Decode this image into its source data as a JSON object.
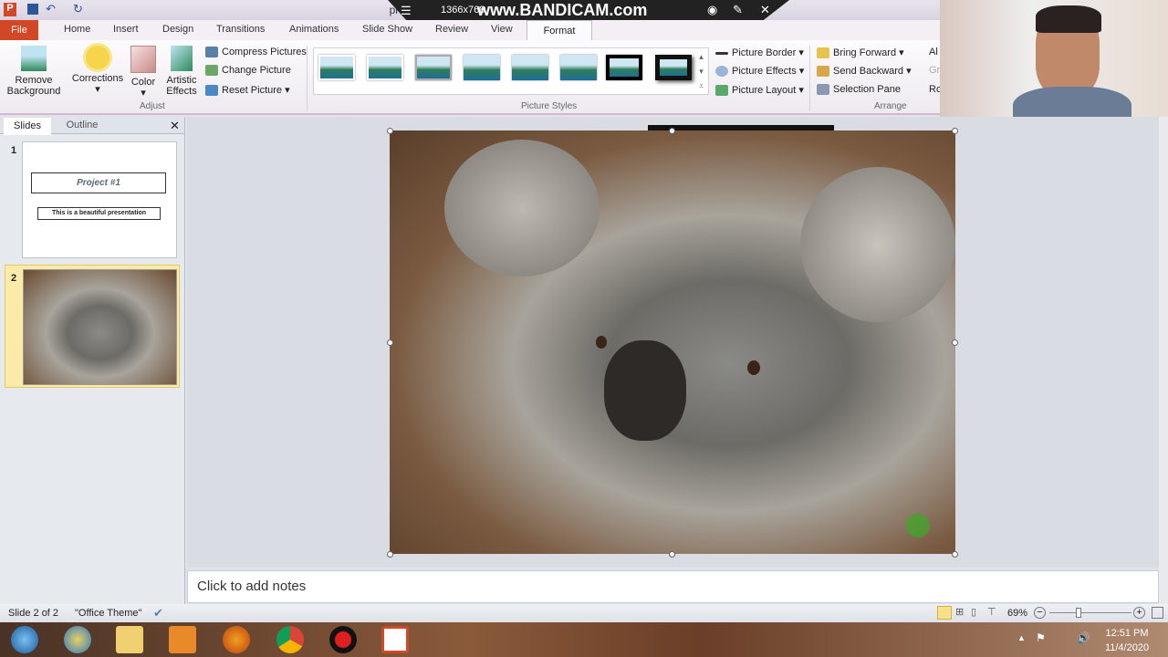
{
  "titlebar": {
    "title": "project #1 - Microsoft PowerPoint",
    "overlay_resolution": "1366x768",
    "overlay_watermark": "www.BANDICAM.com"
  },
  "tabs": {
    "file": "File",
    "items": [
      "Home",
      "Insert",
      "Design",
      "Transitions",
      "Animations",
      "Slide Show",
      "Review",
      "View"
    ],
    "active": "Format"
  },
  "ribbon": {
    "adjust": {
      "remove_background": [
        "Remove",
        "Background"
      ],
      "corrections": "Corrections",
      "color": "Color",
      "artistic_effects": [
        "Artistic",
        "Effects"
      ],
      "compress": "Compress Pictures",
      "change": "Change Picture",
      "reset": "Reset Picture",
      "group": "Adjust"
    },
    "styles": {
      "group": "Picture Styles",
      "border": "Picture Border",
      "effects": "Picture Effects",
      "layout": "Picture Layout"
    },
    "arrange": {
      "group": "Arrange",
      "bring_forward": "Bring Forward",
      "send_backward": "Send Backward",
      "selection_pane": "Selection Pane",
      "align": "Al",
      "group_btn": "Gr",
      "rotate": "Ro"
    }
  },
  "panel": {
    "tabs": [
      "Slides",
      "Outline"
    ],
    "slides": [
      {
        "num": "1",
        "title": "Project #1",
        "subtitle": "This is a beautiful presentation"
      },
      {
        "num": "2"
      }
    ]
  },
  "notes": {
    "placeholder": "Click to add notes"
  },
  "status": {
    "slide": "Slide 2 of 2",
    "theme": "\"Office Theme\"",
    "zoom": "69%",
    "zoom_fraction": 0.35
  },
  "taskbar": {
    "time": "12:51 PM",
    "date": "11/4/2020"
  }
}
